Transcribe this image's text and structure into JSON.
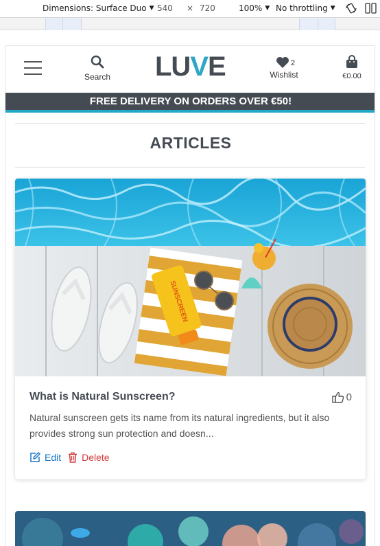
{
  "devtools": {
    "dimensions_label": "Dimensions: Surface Duo",
    "width": "540",
    "times": "×",
    "height": "720",
    "zoom": "100%",
    "throttling": "No throttling"
  },
  "header": {
    "logo_main": "LU",
    "logo_accent": "V",
    "logo_end": "E",
    "search_label": "Search",
    "wishlist_label": "Wishlist",
    "wishlist_count": "2",
    "bag_total": "€0.00"
  },
  "promo": {
    "text": "FREE DELIVERY ON ORDERS OVER €50!"
  },
  "page": {
    "title": "ARTICLES"
  },
  "articles": [
    {
      "title": "What is Natural Sunscreen?",
      "likes": "0",
      "excerpt": "Natural sunscreen gets its name from its natural ingredients, but it also provides strong sun protection and doesn...",
      "edit_label": "Edit",
      "delete_label": "Delete",
      "image_product_text": "SUNSCREEN"
    }
  ],
  "colors": {
    "brand_dark": "#454b53",
    "brand_accent": "#2fa6c4",
    "edit": "#1a78c9",
    "delete": "#d23a3a"
  }
}
